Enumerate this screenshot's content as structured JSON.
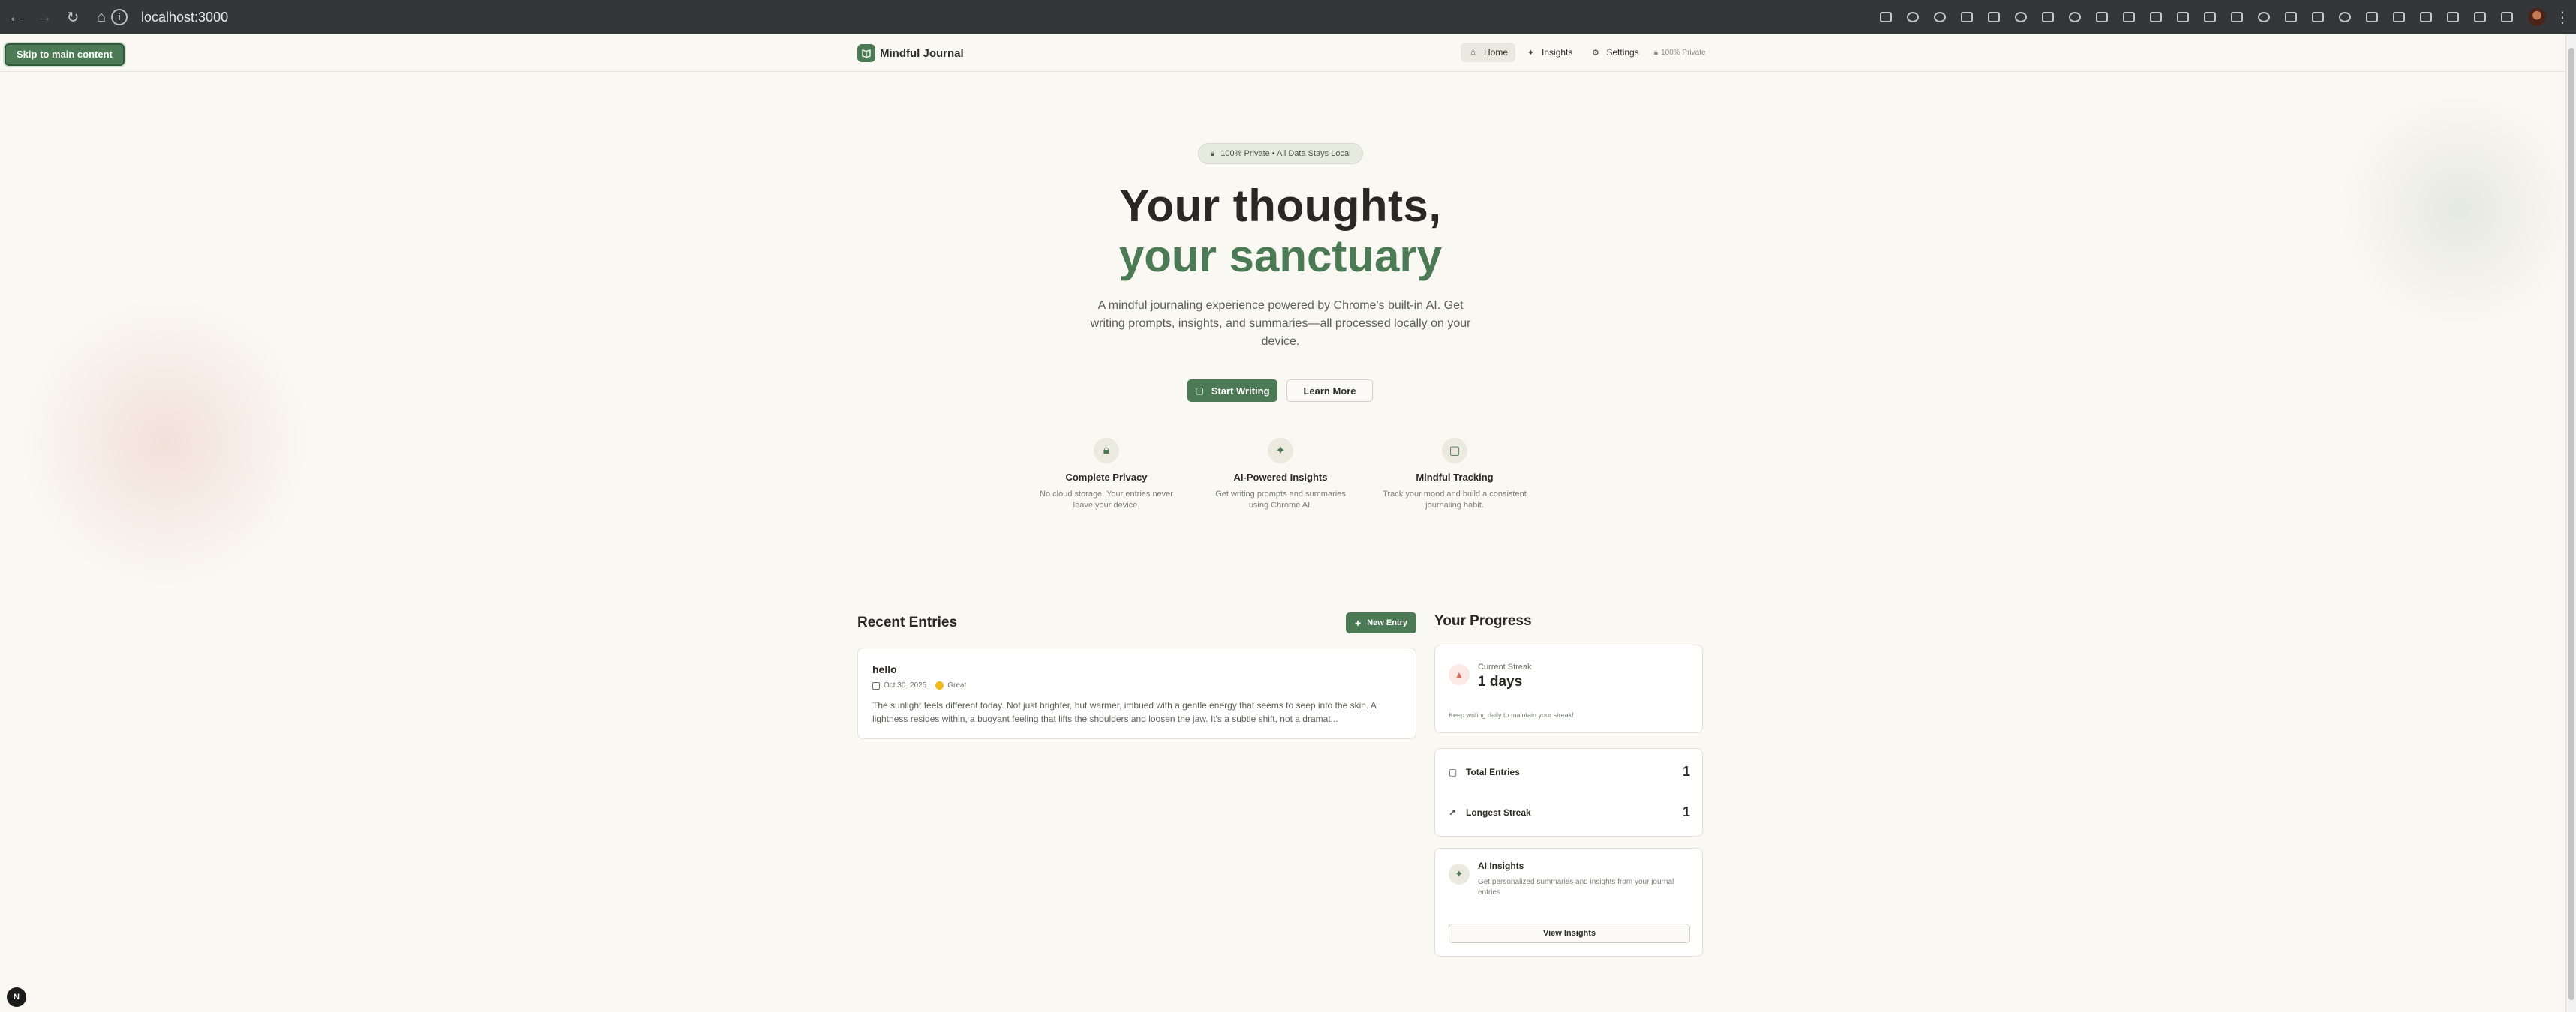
{
  "browser": {
    "url": "localhost:3000"
  },
  "app": {
    "skip_link": "Skip to main content",
    "brand": "Mindful Journal",
    "nav": [
      {
        "label": "Home",
        "icon": "home-icon",
        "active": true
      },
      {
        "label": "Insights",
        "icon": "sparkles-icon",
        "active": false
      },
      {
        "label": "Settings",
        "icon": "gear-icon",
        "active": false
      }
    ],
    "private_badge": "100% Private"
  },
  "hero": {
    "pill": "100% Private • All Data Stays Local",
    "title_line1": "Your thoughts,",
    "title_line2": "your sanctuary",
    "lead": "A mindful journaling experience powered by Chrome's built-in AI. Get writing prompts, insights, and summaries—all processed locally on your device.",
    "primary_cta": "Start Writing",
    "secondary_cta": "Learn More",
    "accent_color": "#4b7a55"
  },
  "features": [
    {
      "icon": "lock-icon",
      "title": "Complete Privacy",
      "desc": "No cloud storage. Your entries never leave your device."
    },
    {
      "icon": "sparkles-icon",
      "title": "AI-Powered Insights",
      "desc": "Get writing prompts and summaries using Chrome AI."
    },
    {
      "icon": "book-icon",
      "title": "Mindful Tracking",
      "desc": "Track your mood and build a consistent journaling habit."
    }
  ],
  "recent": {
    "title": "Recent Entries",
    "new_entry": "New Entry",
    "entries": [
      {
        "title": "hello",
        "date": "Oct 30, 2025",
        "mood": "Great",
        "excerpt": "The sunlight feels different today. Not just brighter, but warmer, imbued with a gentle energy that seems to seep into the skin. A lightness resides within, a buoyant feeling that lifts the shoulders and loosen the jaw. It's a subtle shift, not a dramat..."
      }
    ]
  },
  "progress": {
    "title": "Your Progress",
    "streak_label": "Current Streak",
    "streak_value": "1 days",
    "streak_hint": "Keep writing daily to maintain your streak!",
    "total_label": "Total Entries",
    "total_value": "1",
    "longest_label": "Longest Streak",
    "longest_value": "1",
    "ai_title": "AI Insights",
    "ai_desc": "Get personalized summaries and insights from your journal entries",
    "ai_button": "View Insights"
  },
  "dev_badge": "N"
}
